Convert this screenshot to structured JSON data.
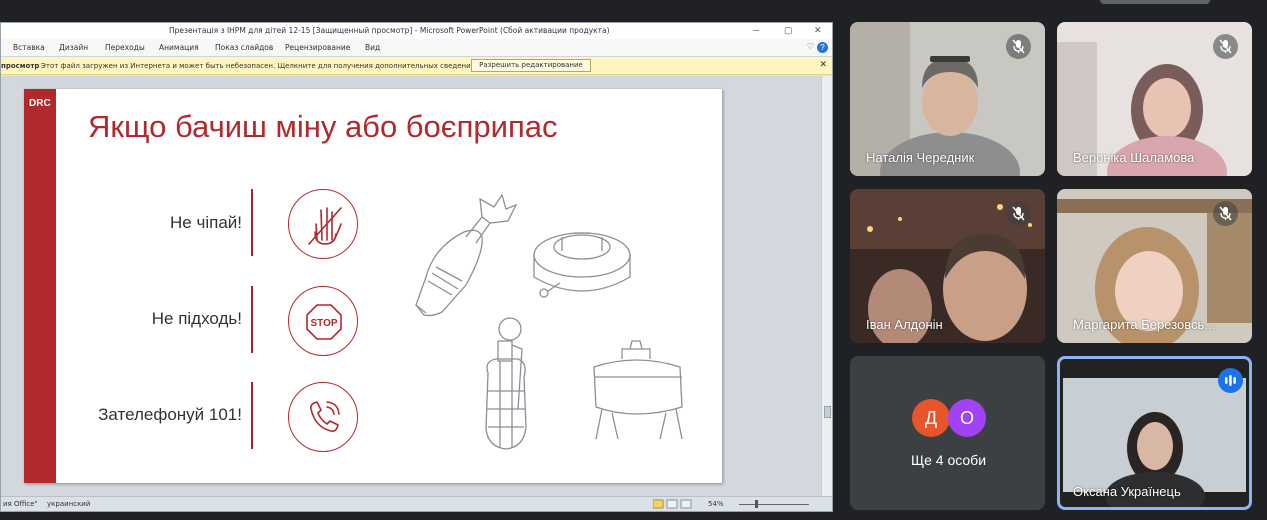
{
  "ppt": {
    "window_title": "Презентація з ІНРМ для дітей 12-15 [Защищенный просмотр] - Microsoft PowerPoint (Сбой активации продукта)",
    "tabs": [
      "Вставка",
      "Дизайн",
      "Переходы",
      "Анимация",
      "Показ слайдов",
      "Рецензирование",
      "Вид"
    ],
    "protected_label": "просмотр",
    "protected_message": "Этот файл загружен из Интернета и может быть небезопасен. Щелкните для получения дополнительных сведений.",
    "enable_editing": "Разрешить редактирование",
    "status_left": "ия Office\"",
    "status_lang": "украинский",
    "zoom": "54%"
  },
  "slide": {
    "logo": "DRC",
    "title": "Якщо бачиш міну або боєприпас",
    "rules": [
      {
        "text": "Не чіпай!",
        "icon": "no-touch-hand-icon"
      },
      {
        "text": "Не підходь!",
        "icon": "stop-sign-icon"
      },
      {
        "text": "Зателефонуй 101!",
        "icon": "phone-icon"
      }
    ],
    "stop_text": "STOP",
    "accent_color": "#b1292c"
  },
  "meet": {
    "participants": [
      {
        "name": "Наталія Чередник",
        "muted": true
      },
      {
        "name": "Вероніка Шаламова",
        "muted": true
      },
      {
        "name": "Іван Алдонін",
        "muted": true
      },
      {
        "name": "Маргарита Березовсь...",
        "muted": true
      },
      {
        "name": "Оксана Українець",
        "muted": false,
        "speaking": true
      }
    ],
    "more": {
      "label": "Ще 4 особи",
      "avatars": [
        {
          "letter": "Д",
          "color": "#e8542b"
        },
        {
          "letter": "О",
          "color": "#a142f4"
        }
      ]
    }
  }
}
